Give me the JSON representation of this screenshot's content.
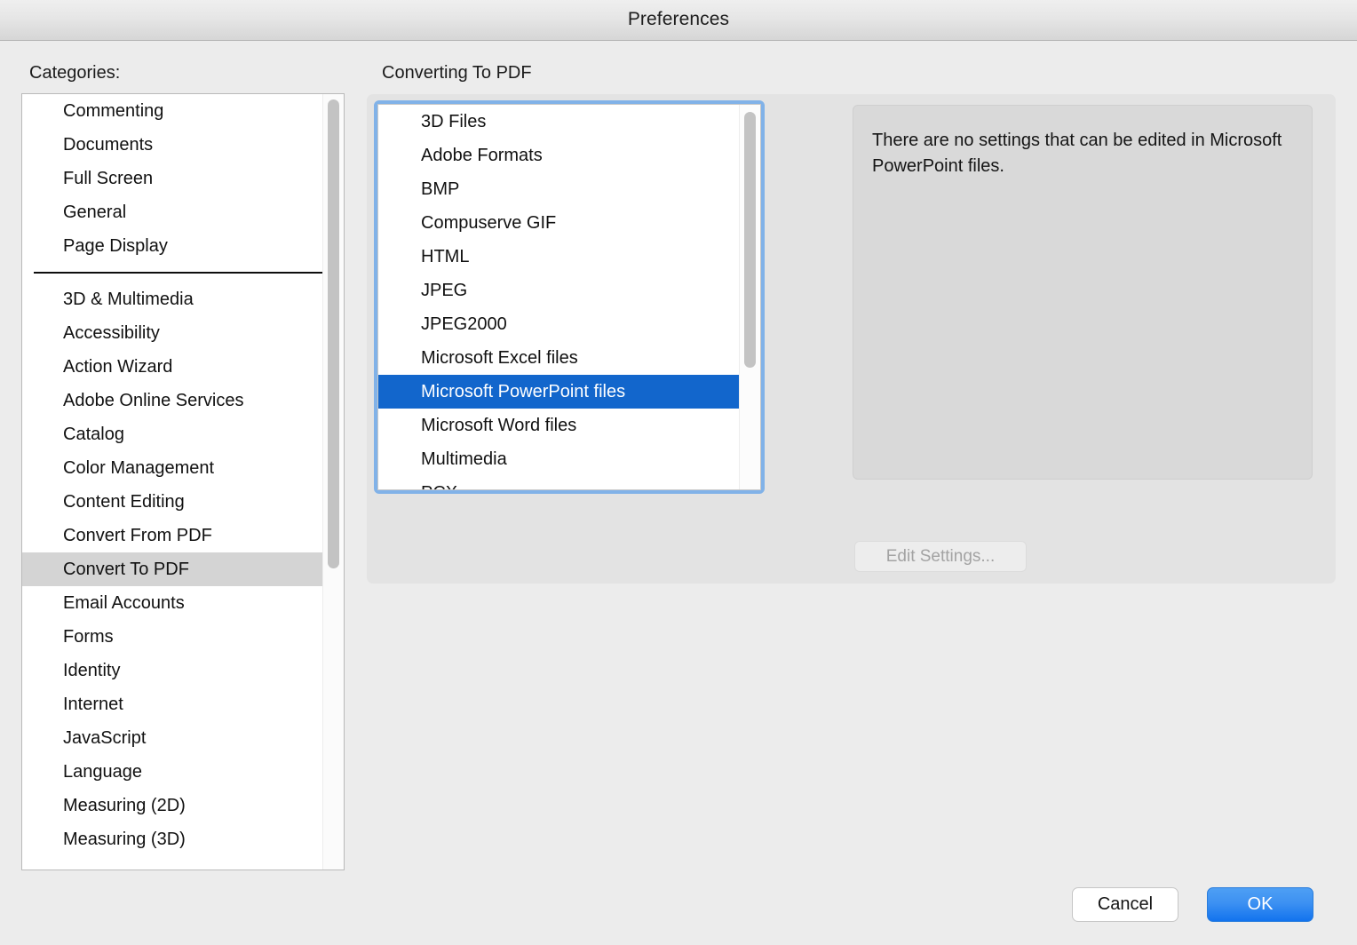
{
  "window": {
    "title": "Preferences"
  },
  "categories": {
    "label": "Categories:",
    "selected": "Convert To PDF",
    "group_one": [
      {
        "label": "Commenting"
      },
      {
        "label": "Documents"
      },
      {
        "label": "Full Screen"
      },
      {
        "label": "General"
      },
      {
        "label": "Page Display"
      }
    ],
    "group_two": [
      {
        "label": "3D & Multimedia"
      },
      {
        "label": "Accessibility"
      },
      {
        "label": "Action Wizard"
      },
      {
        "label": "Adobe Online Services"
      },
      {
        "label": "Catalog"
      },
      {
        "label": "Color Management"
      },
      {
        "label": "Content Editing"
      },
      {
        "label": "Convert From PDF"
      },
      {
        "label": "Convert To PDF"
      },
      {
        "label": "Email Accounts"
      },
      {
        "label": "Forms"
      },
      {
        "label": "Identity"
      },
      {
        "label": "Internet"
      },
      {
        "label": "JavaScript"
      },
      {
        "label": "Language"
      },
      {
        "label": "Measuring (2D)"
      },
      {
        "label": "Measuring (3D)"
      }
    ]
  },
  "panel": {
    "section_label": "Converting To PDF",
    "selected_format": "Microsoft PowerPoint files",
    "formats": [
      {
        "label": "3D Files"
      },
      {
        "label": "Adobe Formats"
      },
      {
        "label": "BMP"
      },
      {
        "label": "Compuserve GIF"
      },
      {
        "label": "HTML"
      },
      {
        "label": "JPEG"
      },
      {
        "label": "JPEG2000"
      },
      {
        "label": "Microsoft Excel files"
      },
      {
        "label": "Microsoft PowerPoint files"
      },
      {
        "label": "Microsoft Word files"
      },
      {
        "label": "Multimedia"
      },
      {
        "label": "PCX"
      }
    ],
    "info_text": "There are no settings that can be edited in Microsoft PowerPoint files.",
    "edit_settings_label": "Edit Settings..."
  },
  "footer": {
    "cancel_label": "Cancel",
    "ok_label": "OK"
  },
  "colors": {
    "selection_blue": "#1266cc",
    "focus_ring_blue": "#81b2e8",
    "ok_button_blue": "#1273ee",
    "category_selection_gray": "#d4d4d4"
  }
}
